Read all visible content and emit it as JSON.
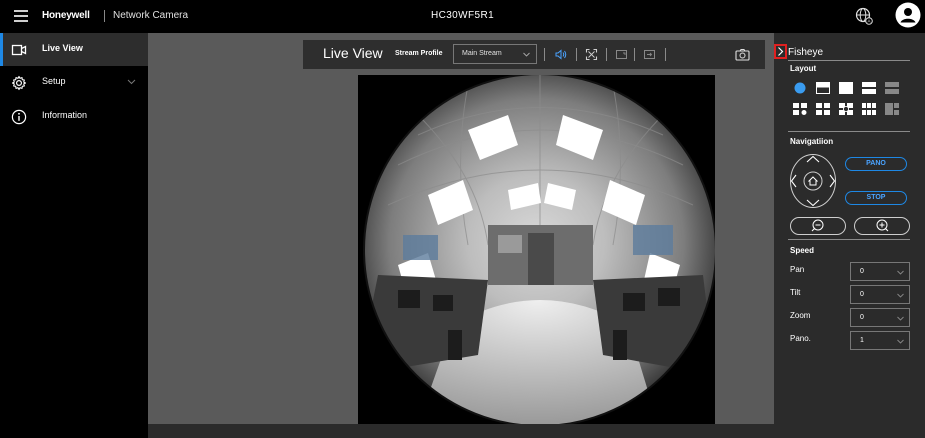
{
  "header": {
    "brand": "Honeywell",
    "product": "Network Camera",
    "model": "HC30WF5R1",
    "icons": [
      "hamburger-menu-icon",
      "globe-language-icon",
      "user-account-icon"
    ]
  },
  "sidebar": {
    "items": [
      {
        "label": "Live View",
        "icon": "video-camera-icon",
        "active": true
      },
      {
        "label": "Setup",
        "icon": "gear-icon",
        "active": false
      },
      {
        "label": "Information",
        "icon": "info-icon",
        "active": false
      }
    ]
  },
  "toolbar": {
    "title": "Live View",
    "stream_profile_label": "Stream Profile",
    "stream_profile_value": "Main Stream",
    "icons": [
      "audio-icon",
      "fullscreen-icon",
      "aspect-ratio-icon",
      "export-icon",
      "snapshot-camera-icon"
    ]
  },
  "panel": {
    "title": "Fisheye",
    "layout_label": "Layout",
    "navigation_label": "Navigatiion",
    "pano_label": "PANO",
    "stop_label": "STOP",
    "speed": {
      "title": "Speed",
      "rows": [
        {
          "label": "Pan",
          "value": "0"
        },
        {
          "label": "Tilt",
          "value": "0"
        },
        {
          "label": "Zoom",
          "value": "0"
        },
        {
          "label": "Pano.",
          "value": "1"
        }
      ]
    }
  },
  "colors": {
    "accent": "#1e88e5",
    "highlight": "#e02020",
    "panel_bg": "#2b2b2b",
    "stage_bg": "#5a5a5a"
  }
}
